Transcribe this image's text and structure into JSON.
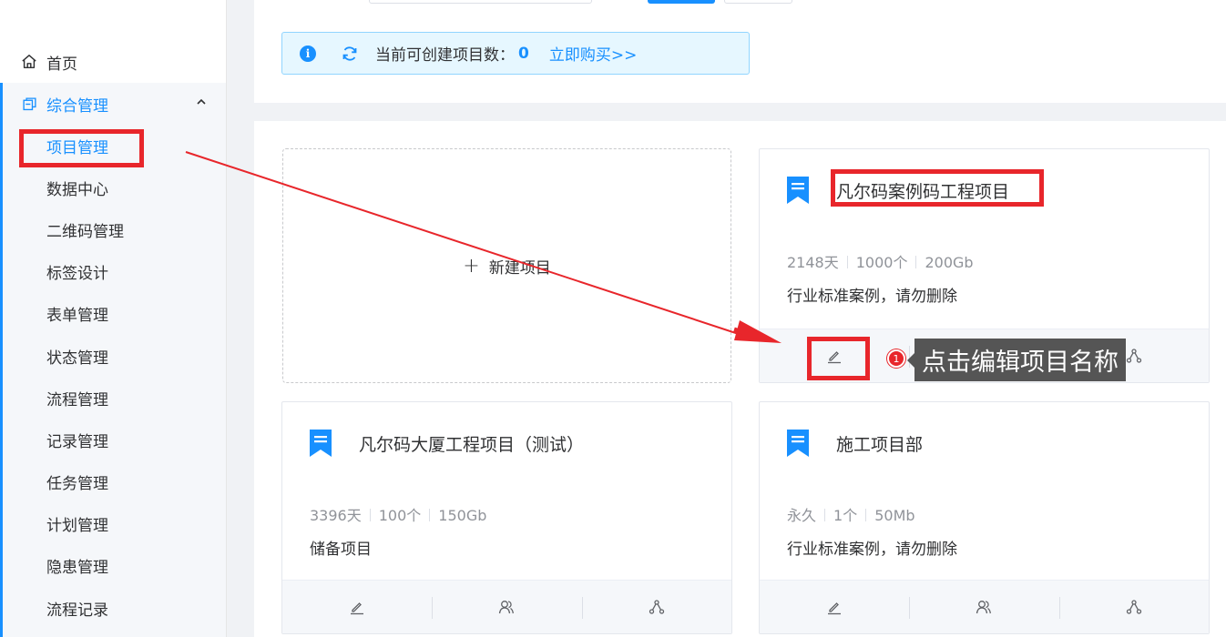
{
  "sidebar": {
    "home": {
      "label": "首页",
      "icon": "home-icon"
    },
    "group": {
      "label": "综合管理",
      "icon": "folder-icon",
      "expanded": true,
      "items": [
        {
          "label": "项目管理",
          "active": true
        },
        {
          "label": "数据中心"
        },
        {
          "label": "二维码管理"
        },
        {
          "label": "标签设计"
        },
        {
          "label": "表单管理"
        },
        {
          "label": "状态管理"
        },
        {
          "label": "流程管理"
        },
        {
          "label": "记录管理"
        },
        {
          "label": "任务管理"
        },
        {
          "label": "计划管理"
        },
        {
          "label": "隐患管理"
        },
        {
          "label": "流程记录"
        }
      ]
    }
  },
  "alert": {
    "label": "当前可创建项目数：",
    "count": "0",
    "buy_link": "立即购买>>"
  },
  "new_project": {
    "label": "新建项目"
  },
  "projects": [
    {
      "title": "凡尔码案例码工程项目",
      "days": "2148天",
      "count": "1000个",
      "storage": "200Gb",
      "desc": "行业标准案例，请勿删除"
    },
    {
      "title": "凡尔码大厦工程项目（测试）",
      "days": "3396天",
      "count": "100个",
      "storage": "150Gb",
      "desc": "储备项目"
    },
    {
      "title": "施工项目部",
      "days": "永久",
      "count": "1个",
      "storage": "50Mb",
      "desc": "行业标准案例，请勿删除"
    }
  ],
  "annotation": {
    "badge": "1",
    "tooltip": "点击编辑项目名称"
  },
  "colors": {
    "accent": "#1890ff",
    "annotation_red": "#e8262b",
    "tooltip_bg": "#555555"
  }
}
